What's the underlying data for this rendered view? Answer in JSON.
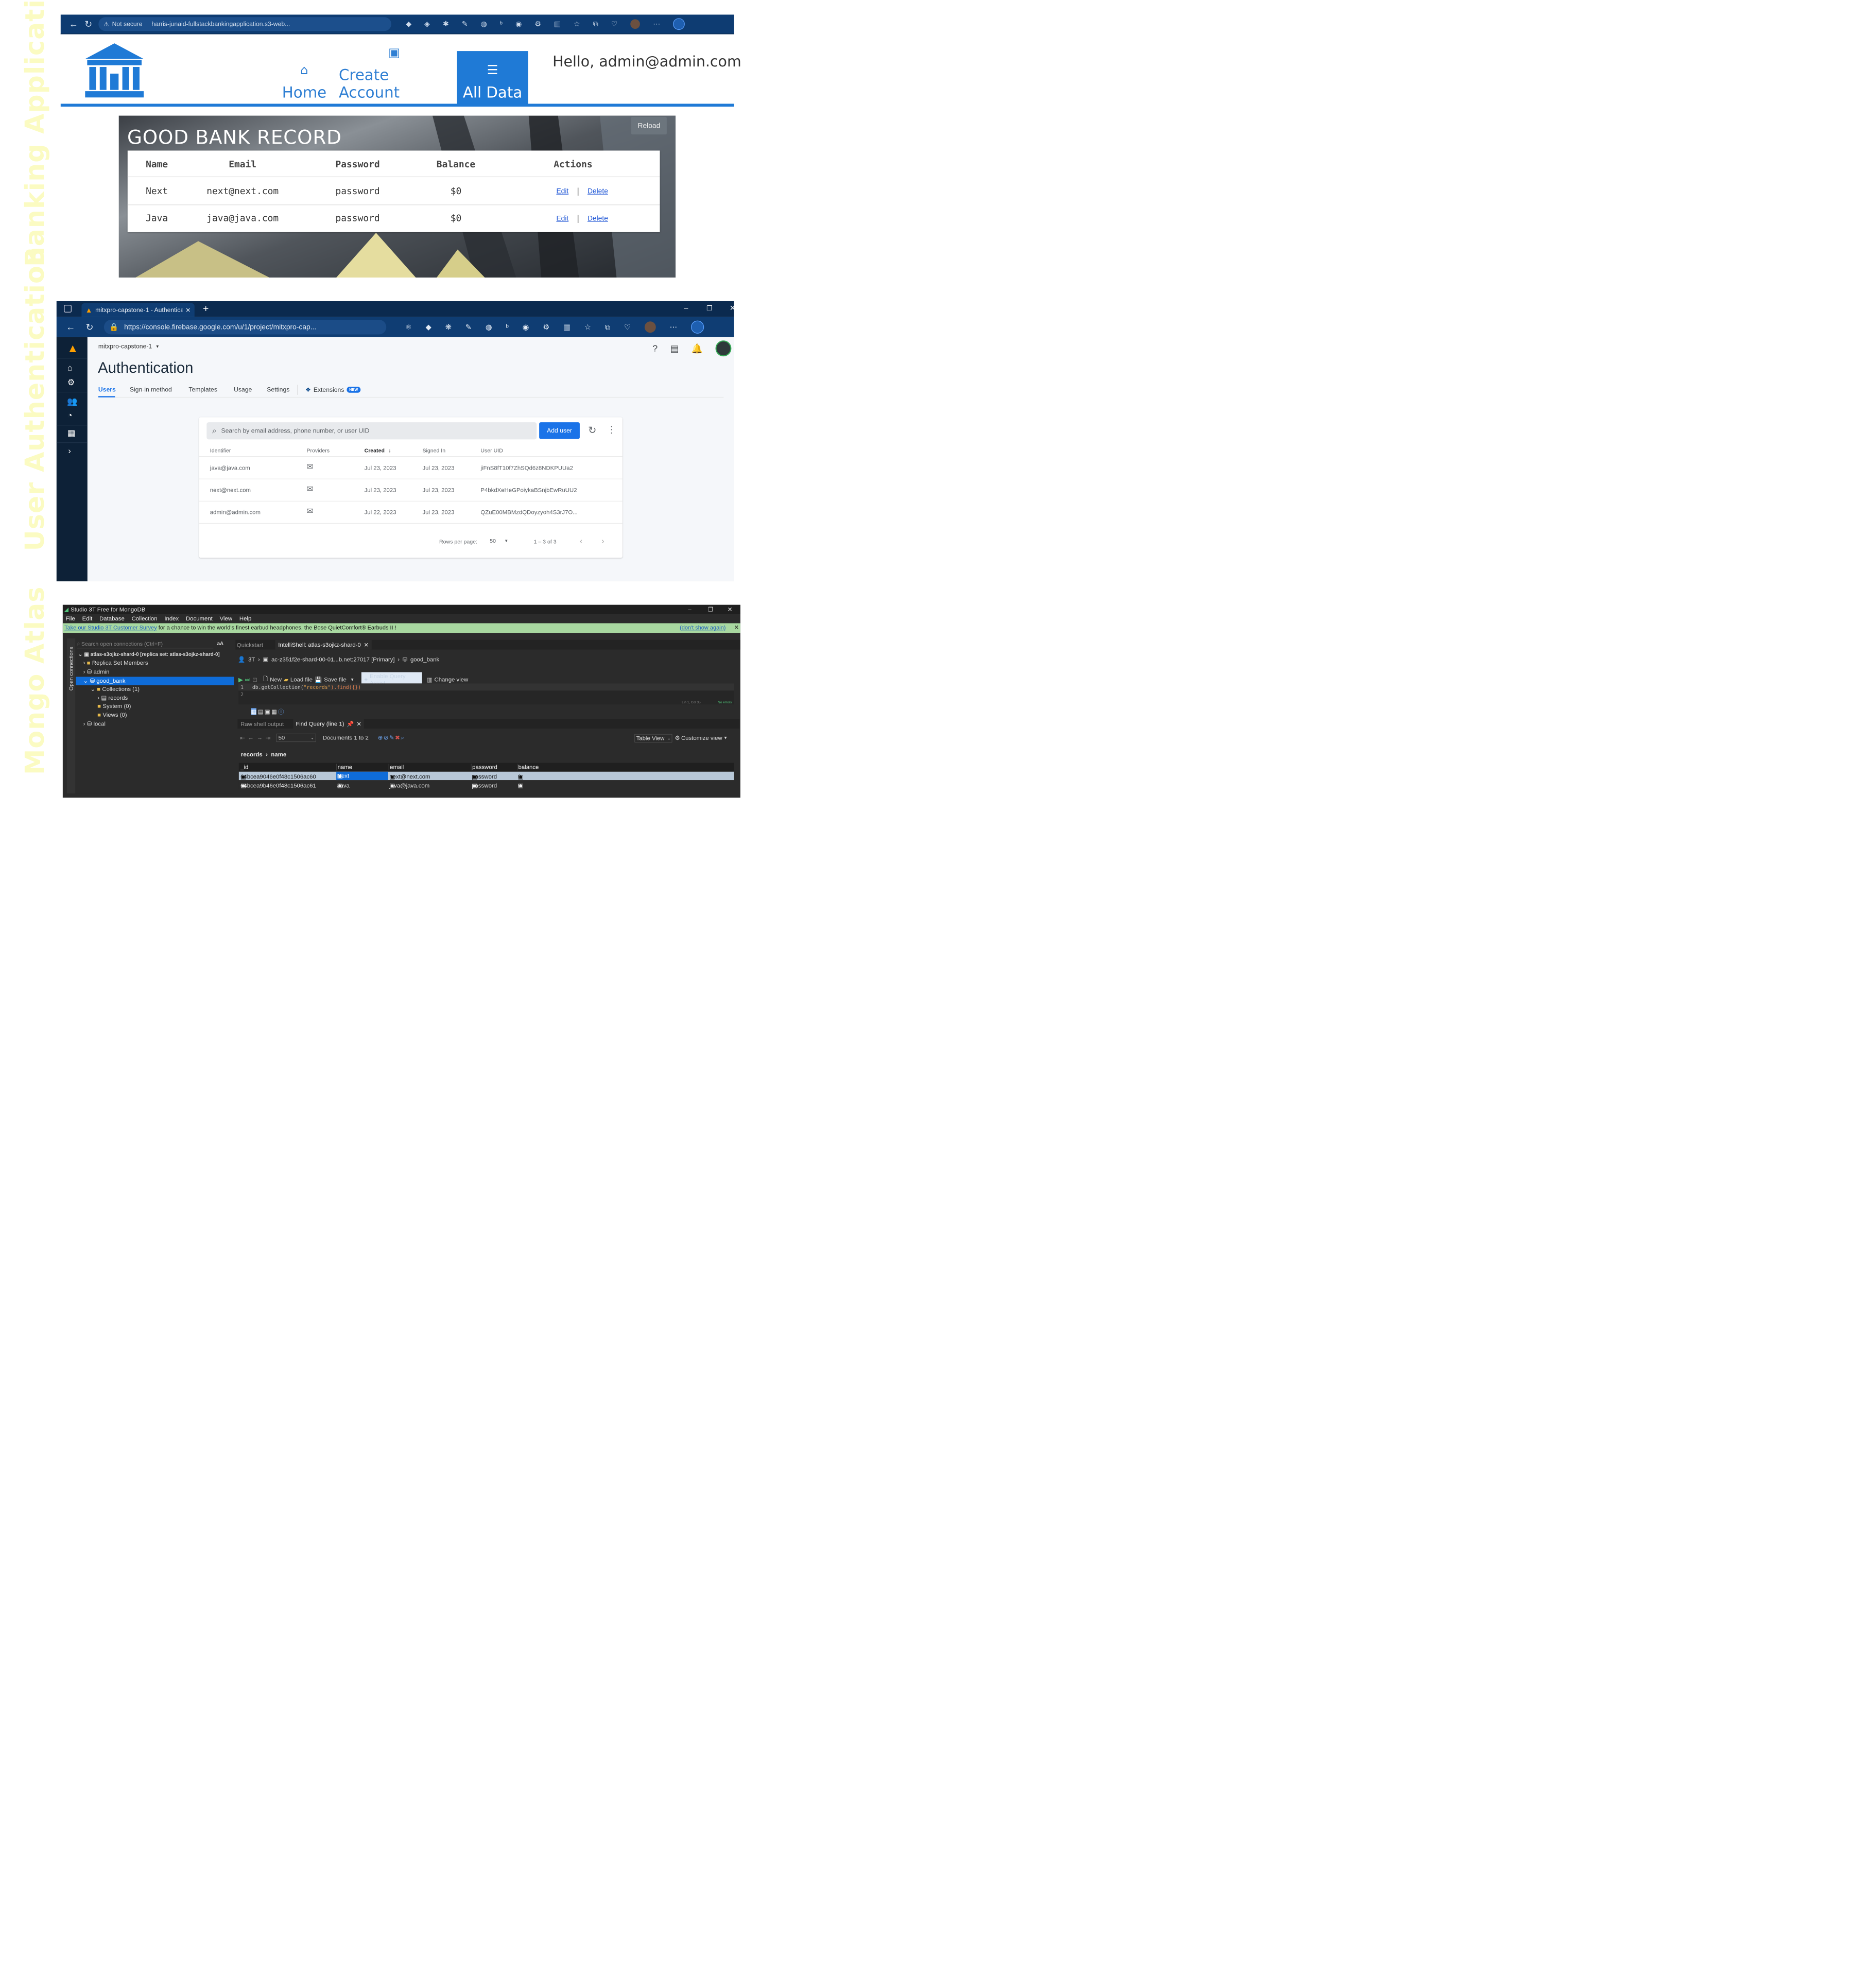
{
  "sections": {
    "s1": "Banking Application",
    "s2": "User Authentication",
    "s3": "Mongo Atlas"
  },
  "bank": {
    "browser": {
      "security": "Not secure",
      "url": "harris-junaid-fullstackbankingapplication.s3-web..."
    },
    "nav": {
      "home": "Home",
      "create": "Create Account",
      "alldata": "All Data",
      "greeting": "Hello, admin@admin.com"
    },
    "title": "GOOD BANK RECORD",
    "reload": "Reload",
    "columns": [
      "Name",
      "Email",
      "Password",
      "Balance",
      "Actions"
    ],
    "rows": [
      {
        "name": "Next",
        "email": "next@next.com",
        "password": "password",
        "balance": "$0"
      },
      {
        "name": "Java",
        "email": "java@java.com",
        "password": "password",
        "balance": "$0"
      }
    ],
    "edit": "Edit",
    "delete": "Delete",
    "sep": "|"
  },
  "firebase": {
    "tab_title": "mitxpro-capstone-1 - Authentica",
    "url": "https://console.firebase.google.com/u/1/project/mitxpro-cap...",
    "project": "mitxpro-capstone-1",
    "heading": "Authentication",
    "tabs": [
      "Users",
      "Sign-in method",
      "Templates",
      "Usage",
      "Settings"
    ],
    "extensions": "Extensions",
    "new_badge": "NEW",
    "search_placeholder": "Search by email address, phone number, or user UID",
    "add_user": "Add user",
    "columns": [
      "Identifier",
      "Providers",
      "Created",
      "Signed In",
      "User UID"
    ],
    "users": [
      {
        "id": "java@java.com",
        "created": "Jul 23, 2023",
        "signed": "Jul 23, 2023",
        "uid": "jiFnS8fT10f7ZhSQd6z8NDKPUUa2"
      },
      {
        "id": "next@next.com",
        "created": "Jul 23, 2023",
        "signed": "Jul 23, 2023",
        "uid": "P4bkdXeHeGPoiykaBSnjbEwRuUU2"
      },
      {
        "id": "admin@admin.com",
        "created": "Jul 22, 2023",
        "signed": "Jul 23, 2023",
        "uid": "QZuE00MBMzdQDoyzyoh4S3rJ7O..."
      }
    ],
    "rows_per_page_label": "Rows per page:",
    "rows_per_page": "50",
    "pagination": "1 – 3 of 3"
  },
  "studio": {
    "title": "Studio 3T Free for MongoDB",
    "menu": [
      "File",
      "Edit",
      "Database",
      "Collection",
      "Index",
      "Document",
      "View",
      "Help"
    ],
    "banner_link": "Take our Studio 3T Customer Survey",
    "banner_text": " for a chance to win the world's finest earbud headphones, the Bose QuietComfort® Earbuds II !",
    "banner_dismiss": "(don't show again)",
    "conn_search": "Search open connections (Ctrl+F)",
    "aA": "aA",
    "open_connections": "Open connections",
    "tree": {
      "conn": "atlas-s3ojkz-shard-0 [replica set: atlas-s3ojkz-shard-0]",
      "replica": "Replica Set Members",
      "admin": "admin",
      "good_bank": "good_bank",
      "collections": "Collections (1)",
      "records": "records",
      "system": "System (0)",
      "views": "Views (0)",
      "local": "local"
    },
    "tabs": [
      "Quickstart",
      "IntelliShell: atlas-s3ojkz-shard-0"
    ],
    "path": {
      "a": "3T",
      "b": "ac-z351f2e-shard-00-01...b.net:27017 [Primary]",
      "c": "good_bank"
    },
    "toolbar": {
      "new": "New",
      "load": "Load file",
      "save": "Save file",
      "assist": "Enable Query Assist",
      "change": "Change view"
    },
    "code": {
      "l1": "1",
      "l2": "2",
      "pre": "db.getCollection(",
      "str": "\"records\"",
      "post": ").find({})",
      "status": "Lin 1, Col 35",
      "errors": "No errors"
    },
    "result_tabs": [
      "Raw shell output",
      "Find Query (line 1)"
    ],
    "page_size": "50",
    "documents": "Documents 1 to 2",
    "table_view": "Table View",
    "customize": "Customize view",
    "crumb": {
      "a": "records",
      "b": "name"
    },
    "columns": [
      "_id",
      "name",
      "email",
      "password",
      "balance"
    ],
    "rows": [
      {
        "id": "64bcea9046e0f48c1506ac60",
        "name": "Next",
        "email": "next@next.com",
        "password": "password",
        "balance": "0"
      },
      {
        "id": "64bcea9b46e0f48c1506ac61",
        "name": "Java",
        "email": "java@java.com",
        "password": "password",
        "balance": "0"
      }
    ]
  },
  "colors": {
    "bank_blue": "#1f7ad6",
    "firebase_navy": "#0d2137",
    "fb_blue": "#1a73e8",
    "studio_dark": "#2b2b2b",
    "select_blue": "#0f6cd8"
  }
}
